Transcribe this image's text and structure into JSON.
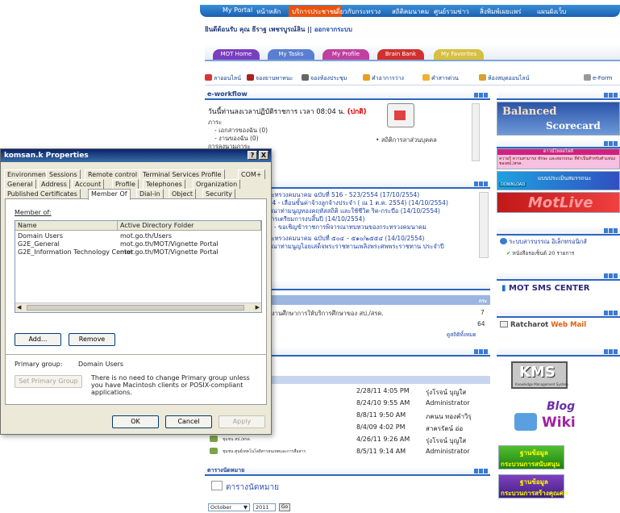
{
  "portal": {
    "topnav": [
      "My Portal",
      "หน้าหลัก",
      "บริการประชาชน",
      "เกี่ยวกับกระทรวง",
      "สถิติคมนาคม",
      "ศูนย์รวมข่าว",
      "สิ่งพิมพ์เผยแพร่",
      "แผนผังเว็บ"
    ],
    "welcome": "ยินดีต้อนรับ คุณ ธีราฐ เพชรบูรณ์ลิน",
    "logout": "ออกจากระบบ",
    "tabs": [
      "MOT Home",
      "My Tasks",
      "My Profile",
      "Brain Bank",
      "My Favorites"
    ],
    "shortcuts": [
      "ลาออนไลน์",
      "จองยานพาหนะ",
      "จองห้องประชุม",
      "คำอาการว่าง",
      "คำสารด่วน",
      "ห้องสมุดออนไลน์",
      "e-Form"
    ],
    "workflow": {
      "title": "e-workflow",
      "line1": "วันนี้ท่านลงเวลาปฏิบัติราชการ เวลา 08:04 น.",
      "status": "(ปกติ)",
      "items": [
        "ภาระ",
        "- เอกสารของฉัน (0)",
        "- งานของฉัน (0)",
        "การลงนามภาระ"
      ],
      "stat": "สถิติการลาส่วนบุคคล"
    },
    "news": [
      "กระทรวงคมนาคม ฉบับที่ 516 - 523/2554 (17/10/2554)",
      "554 - เลื่อนขั้นค่าจ้างลูกจ้างประจำ ( ณ 1 ต.ค. 2554) (14/10/2554)",
      "ธุรณาท่ามนูญทองคฤหัสสถิติ และใช้ชีวิต ริค-กระบือ (14/10/2554)",
      "งการเตรียมการงบสิ้นปี (14/10/2554)",
      "54 - ขอเชิญข้าราชการพิจารณาทบทวนของกระทรวงคมนาคม",
      "กระทรวงคมนาคม ฉบับที่ ๕๐๔ – ๕๑๐/๒๕๕๔ (14/10/2554)",
      "ธุรณาท่ามนูญไอยเสด็จพระราชทานเพลิงพระศพพระราชทาน ประจำปี"
    ],
    "board": {
      "col": "กระ",
      "rows": [
        {
          "text": "ผลงานศึกษาการให้บริการศึกษาของ สป./สรค.",
          "count": "7"
        },
        {
          "text": "",
          "count": "64"
        }
      ],
      "more": "ดูสถิติทั้งหมด"
    },
    "docs": [
      {
        "date": "2/28/11 4:05 PM",
        "by": "รุ่งโรจน์ บุญใส"
      },
      {
        "date": "8/24/10 9:55 AM",
        "by": "Administrator"
      },
      {
        "date": "8/8/11 9:50 AM",
        "by": "ภคนน ทองคำวิรุ"
      },
      {
        "date": "8/4/09 4:02 PM",
        "by": "สาครรัตน์ อ่อ"
      },
      {
        "date": "4/26/11 9:26 AM",
        "by": "รุ่งโรจน์ บุญใส"
      },
      {
        "date": "8/5/11 9:14 AM",
        "by": "Administrator"
      }
    ],
    "doc_labels": [
      "",
      "",
      "",
      "",
      "ชุมชน สป./สรค.",
      "ชุมชน ศูนย์เทคโนโลยีสารสนเทศและการสื่อสาร"
    ],
    "calendar": {
      "header": "ตารางนัดหมาย",
      "title": "ตารางนัดหมาย",
      "month": "October",
      "year": "2011",
      "go": "Go"
    },
    "right": {
      "balanced1": "Balanced",
      "balanced2": "Scorecard",
      "download_title": "ดาวน์โหลดไฟล์",
      "download_text": "ความรู้ ความสามารถ ทักษะ และสมรรถนะ ที่จำเป็นสำหรับตำแหน่ง ของสป./สรค.",
      "download_btn": "DOWNLOAD",
      "assess": "แบบประเมินสมรรถนะ",
      "motlive": "MotLive",
      "ebook": "ระบบสารบรรณ อิเล็กทรอนิกส์",
      "ebook_sub": "หนังสือรอเซ็นต์ 20 รายการ",
      "sms": "MOT SMS CENTER",
      "mail1": "Ratcharot",
      "mail2": "Web Mail",
      "kms": "KMS",
      "kms_sub": "Knowledge Management System",
      "blog": "Blog",
      "wiki": "Wiki",
      "db1a": "ฐานข้อมูล",
      "db1b": "กระบวนการสนับสนุน",
      "db2a": "ฐานข้อมูล",
      "db2b": "กระบวนการสร้างคุณค่า"
    }
  },
  "dialog": {
    "title": "komsan.k Properties",
    "help_btn": "?",
    "close_btn": "X",
    "tabs_row1": [
      "Environment",
      "Sessions",
      "Remote control",
      "Terminal Services Profile",
      "COM+"
    ],
    "tabs_row2": [
      "General",
      "Address",
      "Account",
      "Profile",
      "Telephones",
      "Organization"
    ],
    "tabs_row3": [
      "Published Certificates",
      "Member Of",
      "Dial-in",
      "Object",
      "Security"
    ],
    "member_of_label": "Member of:",
    "columns": [
      "Name",
      "Active Directory Folder"
    ],
    "rows": [
      {
        "name": "Domain Users",
        "folder": "mot.go.th/Users"
      },
      {
        "name": "G2E_General",
        "folder": "mot.go.th/MOT/Vignette Portal"
      },
      {
        "name": "G2E_Information Technology Center",
        "folder": "mot.go.th/MOT/Vignette Portal"
      }
    ],
    "add_btn": "Add...",
    "remove_btn": "Remove",
    "primary_group_label": "Primary group:",
    "primary_group_value": "Domain Users",
    "set_primary_btn": "Set Primary Group",
    "note": "There is no need to change Primary group unless you have Macintosh clients or POSIX-compliant applications.",
    "ok_btn": "OK",
    "cancel_btn": "Cancel",
    "apply_btn": "Apply"
  }
}
